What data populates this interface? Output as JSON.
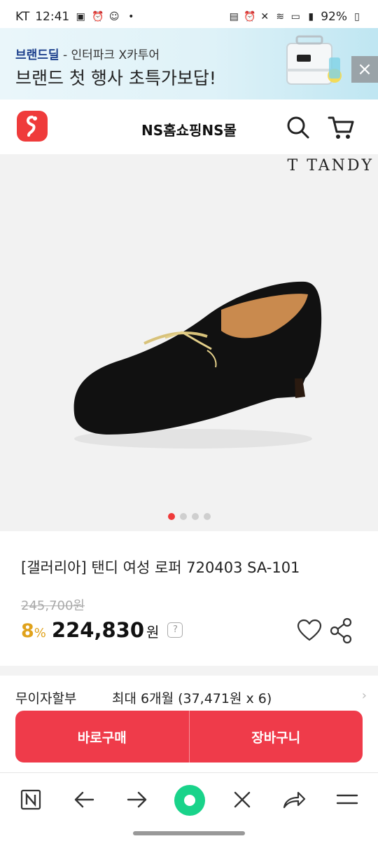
{
  "status_bar": {
    "carrier": "KT",
    "time": "12:41",
    "battery": "92%"
  },
  "ad_banner": {
    "brand": "브랜드딜",
    "brand_sub": " - 인터파크 X카투어",
    "headline": "브랜드 첫 행사 초특가보답!"
  },
  "header": {
    "title": "NS홈쇼핑NS몰"
  },
  "product_image": {
    "brand_mark": "TANDY",
    "slide_count": 4,
    "active_slide": 1
  },
  "product": {
    "name": "[갤러리아] 탠디 여성 로퍼 720403 SA-101",
    "original_price": "245,700원",
    "discount": "8",
    "discount_unit": "%",
    "price": "224,830",
    "price_unit": "원",
    "help": "?"
  },
  "installment": {
    "label": "무이자할부",
    "value": "최대 6개월 (37,471원 x 6)"
  },
  "actions": {
    "buy_now": "바로구매",
    "cart": "장바구니"
  },
  "colors": {
    "accent": "#ef3b4a",
    "discount": "#e0a21b",
    "banner_bg": "#dff2f8"
  },
  "bottom_nav": {
    "icons": [
      "n-home-icon",
      "back-arrow-icon",
      "forward-arrow-icon",
      "green-dot-icon",
      "close-icon",
      "share-arrow-icon",
      "menu-icon"
    ]
  }
}
